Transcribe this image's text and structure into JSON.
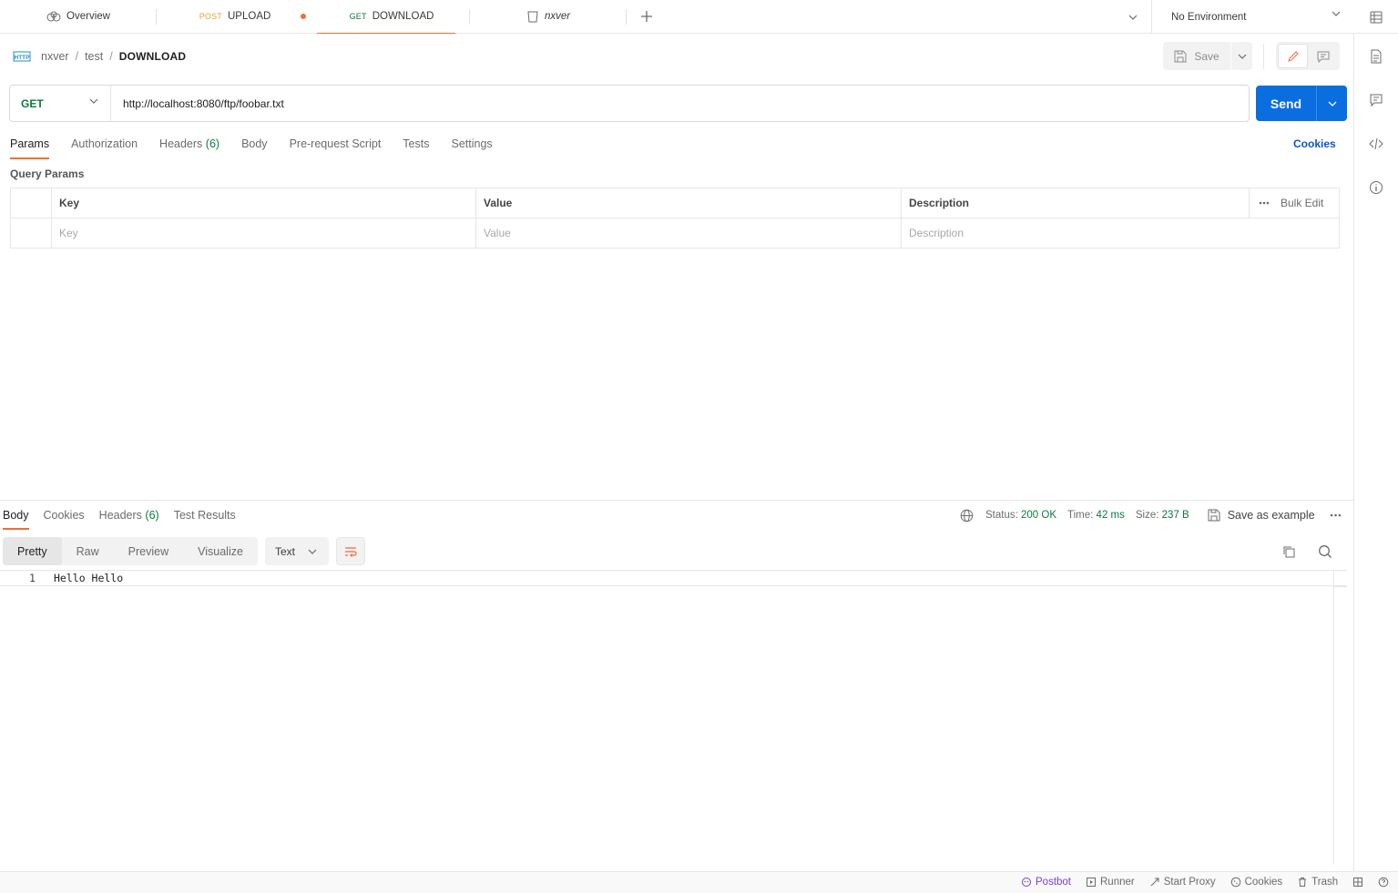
{
  "tabs": [
    {
      "method": "",
      "label": "Overview",
      "icon": "overview-icon"
    },
    {
      "method": "POST",
      "label": "UPLOAD",
      "unsaved": true
    },
    {
      "method": "GET",
      "label": "DOWNLOAD",
      "active": true
    },
    {
      "method": "",
      "label": "nxver",
      "icon": "collection-icon"
    }
  ],
  "environment": {
    "label": "No Environment"
  },
  "breadcrumb": {
    "parts": [
      "nxver",
      "test"
    ],
    "current": "DOWNLOAD"
  },
  "toolbar": {
    "save_label": "Save"
  },
  "request": {
    "method": "GET",
    "url": "http://localhost:8080/ftp/foobar.txt",
    "send_label": "Send"
  },
  "request_tabs": [
    {
      "label": "Params",
      "active": true
    },
    {
      "label": "Authorization"
    },
    {
      "label": "Headers",
      "count": "(6)"
    },
    {
      "label": "Body"
    },
    {
      "label": "Pre-request Script"
    },
    {
      "label": "Tests"
    },
    {
      "label": "Settings"
    }
  ],
  "cookies_link": "Cookies",
  "query_params": {
    "title": "Query Params",
    "headers": {
      "key": "Key",
      "value": "Value",
      "description": "Description",
      "bulk_edit": "Bulk Edit"
    },
    "placeholders": {
      "key": "Key",
      "value": "Value",
      "description": "Description"
    }
  },
  "response_tabs": [
    {
      "label": "Body",
      "active": true
    },
    {
      "label": "Cookies"
    },
    {
      "label": "Headers",
      "count": "(6)"
    },
    {
      "label": "Test Results"
    }
  ],
  "response_meta": {
    "status_label": "Status:",
    "status": "200 OK",
    "time_label": "Time:",
    "time": "42 ms",
    "size_label": "Size:",
    "size": "237 B",
    "save_example": "Save as example"
  },
  "format": {
    "modes": [
      "Pretty",
      "Raw",
      "Preview",
      "Visualize"
    ],
    "active": "Pretty",
    "type": "Text"
  },
  "body": {
    "line_number": "1",
    "text": "Hello Hello"
  },
  "statusbar": [
    "Postbot",
    "Runner",
    "Start Proxy",
    "Cookies",
    "Trash"
  ],
  "colors": {
    "accent": "#f26b3a",
    "send": "#0a6ee0",
    "get": "#0c7a3d",
    "post": "#e3a23b",
    "link": "#0a57c8"
  }
}
